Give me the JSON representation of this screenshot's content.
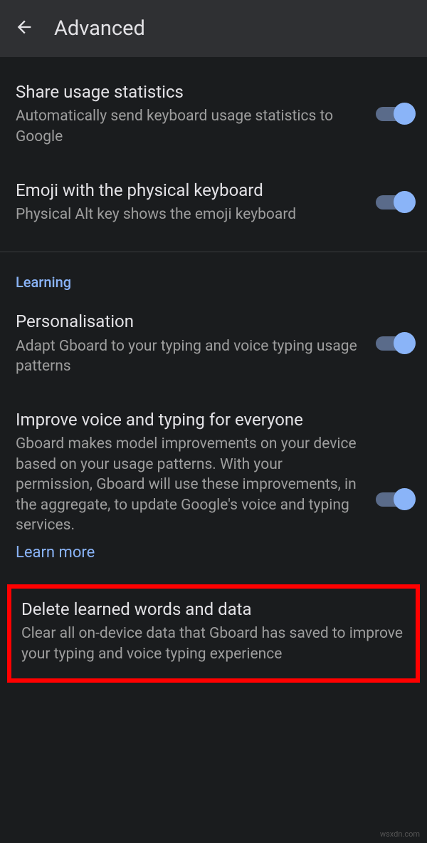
{
  "header": {
    "title": "Advanced"
  },
  "settings": {
    "share_stats": {
      "title": "Share usage statistics",
      "desc": "Automatically send keyboard usage statistics to Google"
    },
    "emoji_physical": {
      "title": "Emoji with the physical keyboard",
      "desc": "Physical Alt key shows the emoji keyboard"
    }
  },
  "learning": {
    "section_label": "Learning",
    "personalisation": {
      "title": "Personalisation",
      "desc": "Adapt Gboard to your typing and voice typing usage patterns"
    },
    "improve": {
      "title": "Improve voice and typing for everyone",
      "desc": "Gboard makes model improvements on your device based on your usage patterns. With your permission, Gboard will use these improvements, in the aggregate, to update Google's voice and typing services.",
      "learn_more": "Learn more"
    },
    "delete": {
      "title": "Delete learned words and data",
      "desc": "Clear all on-device data that Gboard has saved to improve your typing and voice typing experience"
    }
  },
  "watermark": "wsxdn.com"
}
